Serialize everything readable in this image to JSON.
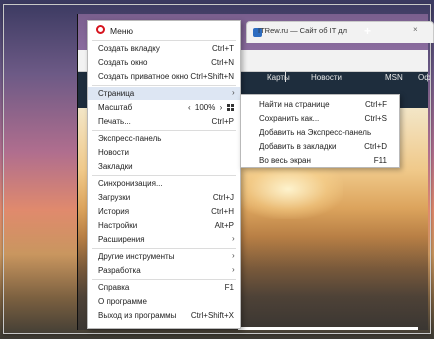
{
  "browser": {
    "tab_title": "ITRew.ru — Сайт об IT дл",
    "tab_close": "×",
    "new_tab": "+"
  },
  "site": {
    "nav": [
      "Карты",
      "Новости",
      "MSN",
      "Офи"
    ]
  },
  "menu": {
    "title": "Меню",
    "items": [
      {
        "label": "Создать вкладку",
        "shortcut": "Ctrl+T"
      },
      {
        "label": "Создать окно",
        "shortcut": "Ctrl+N"
      },
      {
        "label": "Создать приватное окно",
        "shortcut": "Ctrl+Shift+N"
      },
      {
        "label": "Страница",
        "shortcut": "›"
      },
      {
        "label": "Масштаб",
        "zoom_dec": "‹",
        "zoom_value": "100%",
        "zoom_inc": "›"
      },
      {
        "label": "Печать...",
        "shortcut": "Ctrl+P"
      },
      {
        "label": "Экспресс-панель",
        "shortcut": ""
      },
      {
        "label": "Новости",
        "shortcut": ""
      },
      {
        "label": "Закладки",
        "shortcut": ""
      },
      {
        "label": "Синхронизация...",
        "shortcut": ""
      },
      {
        "label": "Загрузки",
        "shortcut": "Ctrl+J"
      },
      {
        "label": "История",
        "shortcut": "Ctrl+H"
      },
      {
        "label": "Настройки",
        "shortcut": "Alt+P"
      },
      {
        "label": "Расширения",
        "shortcut": "›"
      },
      {
        "label": "Другие инструменты",
        "shortcut": "›"
      },
      {
        "label": "Разработка",
        "shortcut": "›"
      },
      {
        "label": "Справка",
        "shortcut": "F1"
      },
      {
        "label": "О программе",
        "shortcut": ""
      },
      {
        "label": "Выход из программы",
        "shortcut": "Ctrl+Shift+X"
      }
    ]
  },
  "submenu": {
    "items": [
      {
        "label": "Найти на странице",
        "shortcut": "Ctrl+F"
      },
      {
        "label": "Сохранить как...",
        "shortcut": "Ctrl+S"
      },
      {
        "label": "Добавить на Экспресс-панель",
        "shortcut": ""
      },
      {
        "label": "Добавить в закладки",
        "shortcut": "Ctrl+D"
      },
      {
        "label": "Во весь экран",
        "shortcut": "F11"
      }
    ]
  }
}
